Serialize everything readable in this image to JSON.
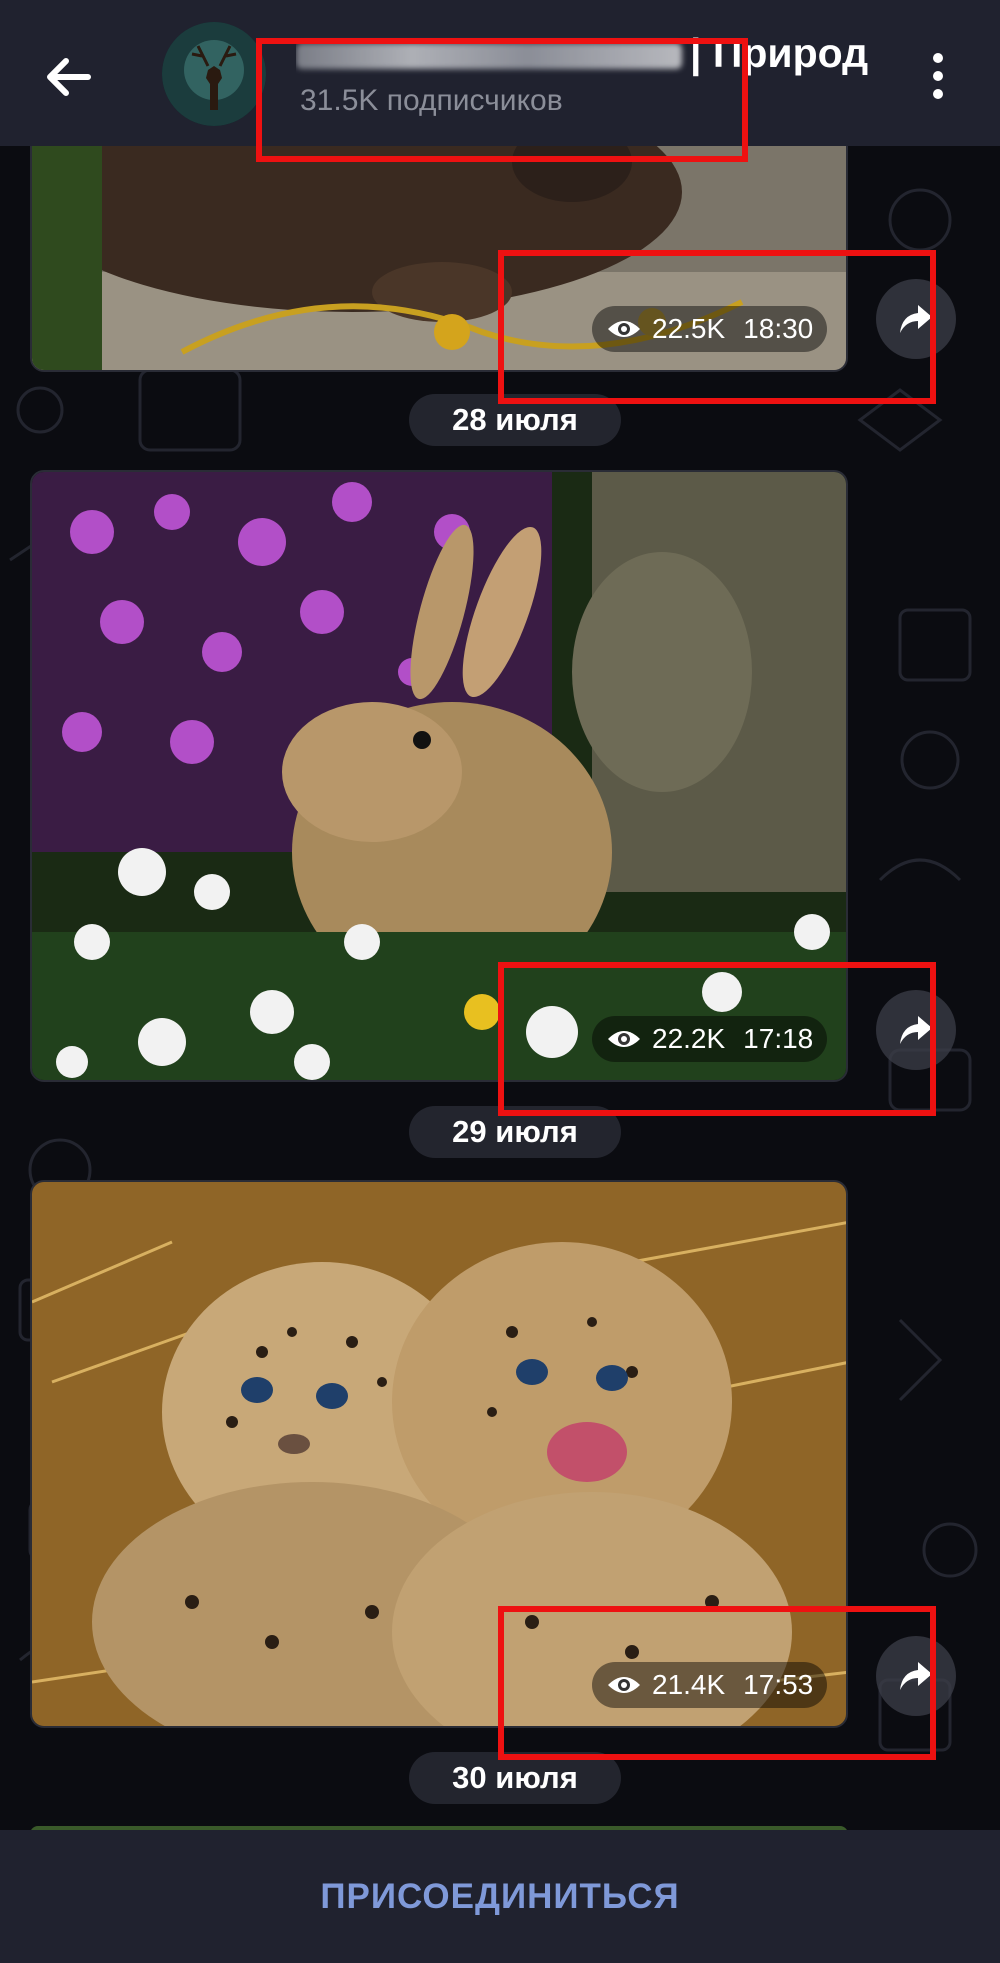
{
  "header": {
    "title_visible": "| Природ",
    "subscribers": "31.5K подписчиков"
  },
  "messages": [
    {
      "views": "22.5K",
      "time": "18:30",
      "image": "beaver-closeup-photo"
    },
    {
      "views": "22.2K",
      "time": "17:18",
      "image": "rabbit-in-flowers-photo"
    },
    {
      "views": "21.4K",
      "time": "17:53",
      "image": "leopard-cubs-photo"
    }
  ],
  "dates": [
    "28 июля",
    "29 июля",
    "30 июля"
  ],
  "footer": {
    "join_label": "ПРИСОЕДИНИТЬСЯ"
  },
  "colors": {
    "header_bg": "#20222f",
    "chat_bg": "#0b0c11",
    "join_text": "#7f99d9",
    "highlight_box": "#ee1111"
  }
}
